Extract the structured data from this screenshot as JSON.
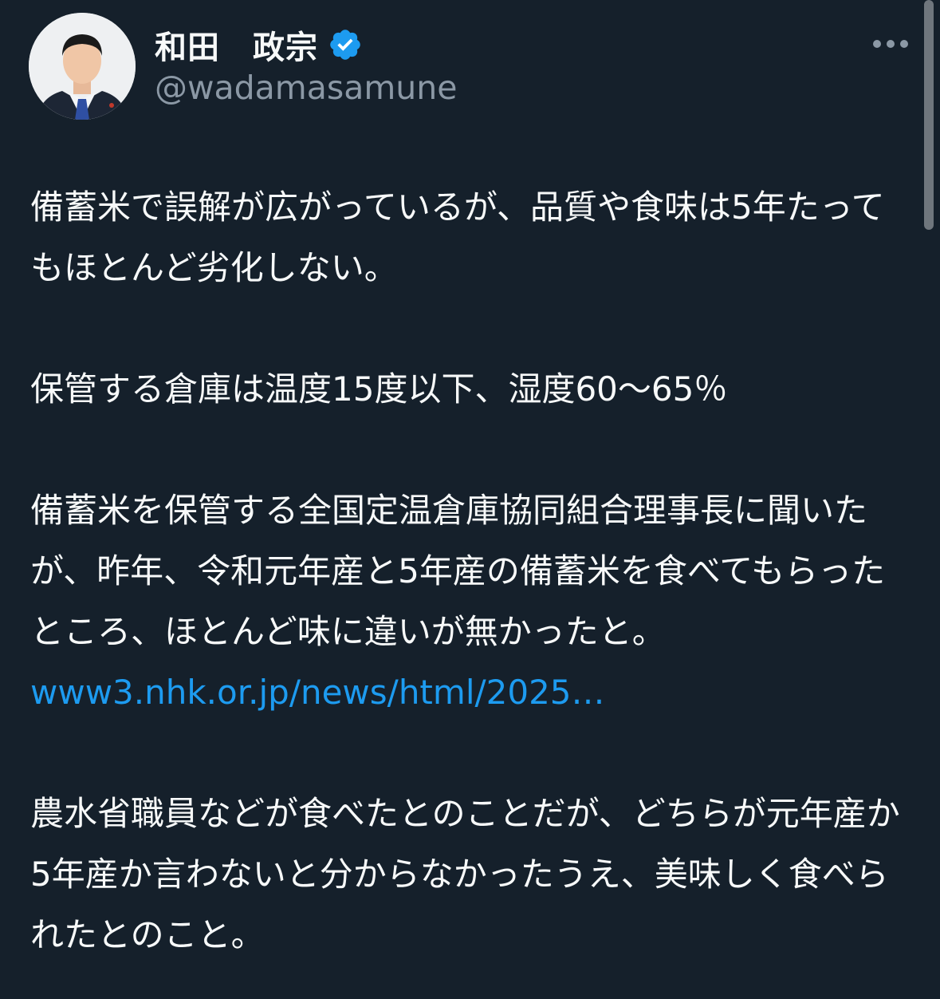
{
  "author": {
    "display_name": "和田　政宗",
    "handle": "@wadamasamune",
    "verified": true,
    "verified_color": "#1d9bf0"
  },
  "header": {
    "more_icon": "more-horizontal-icon"
  },
  "tweet": {
    "paragraph1": "備蓄米で誤解が広がっているが、品質や食味は5年たってもほとんど劣化しない。",
    "paragraph2": "保管する倉庫は温度15度以下、湿度60〜65％",
    "paragraph3_text": "備蓄米を保管する全国定温倉庫協同組合理事長に聞いたが、昨年、令和元年産と5年産の備蓄米を食べてもらったところ、ほとんど味に違いが無かったと。",
    "paragraph3_link": "www3.nhk.or.jp/news/html/2025…",
    "paragraph4": "農水省職員などが食べたとのことだが、どちらが元年産か5年産か言わないと分からなかったうえ、美味しく食べられたとのこと。"
  },
  "colors": {
    "background": "#15202b",
    "text": "#f7f9f9",
    "secondary_text": "#8b98a5",
    "link": "#1d9bf0"
  }
}
